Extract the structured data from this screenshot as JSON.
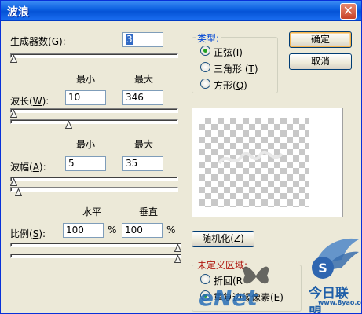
{
  "window": {
    "title": "波浪",
    "close_glyph": "✕"
  },
  "generators": {
    "label": "生成器数(",
    "key": "G",
    "suffix": "):",
    "value": "3"
  },
  "col_headers": {
    "min": "最小",
    "max": "最大",
    "horizontal": "水平",
    "vertical": "垂直"
  },
  "wavelength": {
    "label": "波长(",
    "key": "W",
    "suffix": "):",
    "min": "10",
    "max": "346"
  },
  "amplitude": {
    "label": "波幅(",
    "key": "A",
    "suffix": "):",
    "min": "5",
    "max": "35"
  },
  "scale": {
    "label": "比例(",
    "key": "S",
    "suffix": "):",
    "h": "100",
    "v": "100",
    "unit": "%"
  },
  "type_group": {
    "title": "类型:",
    "options": [
      {
        "label": "正弦(",
        "key": "I",
        "suffix": ")",
        "selected": true
      },
      {
        "label": "三角形 (",
        "key": "T",
        "suffix": ")",
        "selected": false
      },
      {
        "label": "方形(",
        "key": "Q",
        "suffix": ")",
        "selected": false
      }
    ]
  },
  "buttons": {
    "ok": "确定",
    "cancel": "取消",
    "randomize": "随机化(Z)"
  },
  "undefined_group": {
    "title": "未定义区域:",
    "options": [
      {
        "label": "折回(R",
        "selected": false
      },
      {
        "label": "重复边缘像素(E)",
        "selected": true
      }
    ]
  },
  "watermark": {
    "brand": "eNet",
    "site_cn": "今日联盟",
    "site_url": "www.8yao.com",
    "logo_letter": "S"
  },
  "slider_levels": {
    "generators": 0.0,
    "wavelength_min": 0.0,
    "wavelength_max": 0.34,
    "amplitude_min": 0.0,
    "amplitude_max": 0.03,
    "scale_h": 1.0,
    "scale_v": 1.0
  },
  "colors": {
    "title_bar": "#0553d6",
    "group_title": "#0046d5",
    "dialog_bg": "#ece9d8"
  }
}
